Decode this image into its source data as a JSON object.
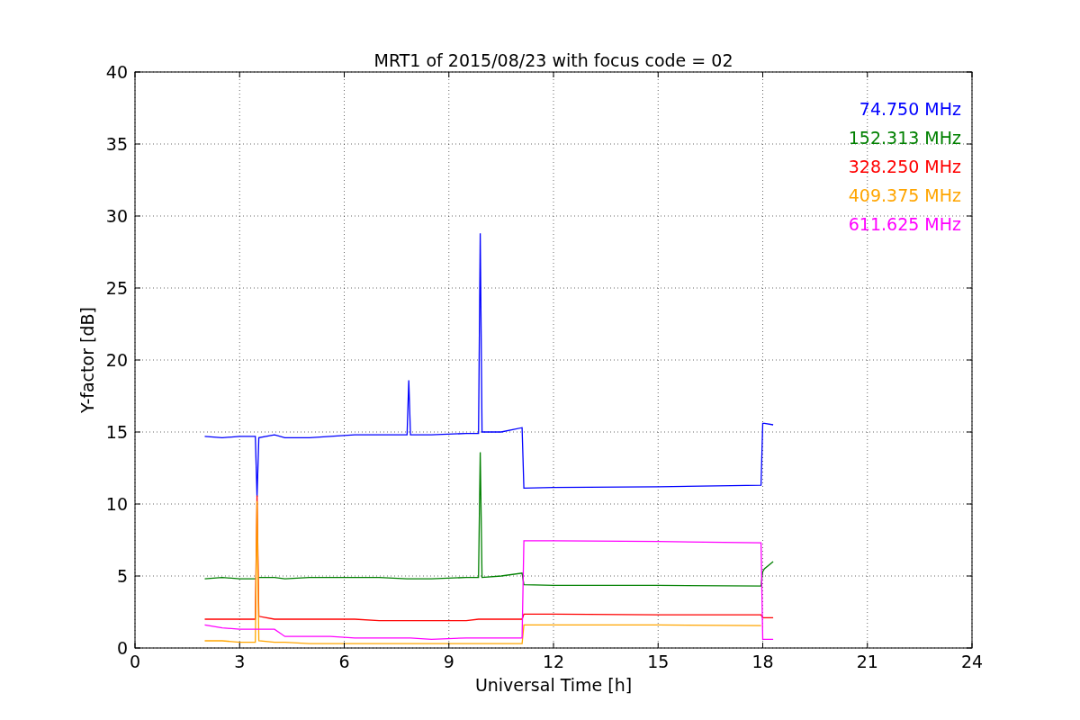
{
  "chart_data": {
    "type": "line",
    "title": "MRT1 of 2015/08/23 with focus code = 02",
    "xlabel": "Universal Time [h]",
    "ylabel": "Y-factor [dB]",
    "grid": true,
    "x": [
      2.0,
      2.5,
      3.0,
      3.45,
      3.5,
      3.55,
      4.0,
      4.3,
      5.0,
      5.6,
      6.3,
      7.0,
      7.8,
      7.85,
      7.9,
      8.5,
      9.5,
      9.85,
      9.9,
      9.95,
      10.5,
      11.1,
      11.15,
      12,
      15,
      17.95,
      18.0,
      18.05,
      18.3
    ],
    "series": [
      {
        "name": "74.750 MHz",
        "color": "#0000ff",
        "values": [
          14.7,
          14.6,
          14.7,
          14.7,
          10.5,
          14.6,
          14.8,
          14.6,
          14.6,
          14.7,
          14.8,
          14.8,
          14.8,
          18.6,
          14.8,
          14.8,
          14.9,
          14.9,
          28.8,
          15.0,
          15.0,
          15.3,
          11.1,
          11.15,
          11.2,
          11.3,
          15.6,
          15.6,
          15.5
        ]
      },
      {
        "name": "152.313 MHz",
        "color": "#008000",
        "values": [
          4.8,
          4.9,
          4.8,
          4.8,
          null,
          4.9,
          4.9,
          4.8,
          4.9,
          4.9,
          4.9,
          4.9,
          4.8,
          4.8,
          4.8,
          4.8,
          4.9,
          4.9,
          13.6,
          4.9,
          5.0,
          5.2,
          4.4,
          4.35,
          4.35,
          4.3,
          5.3,
          5.5,
          6.0
        ]
      },
      {
        "name": "328.250 MHz",
        "color": "#ff0000",
        "values": [
          2.0,
          2.0,
          2.0,
          2.0,
          10.6,
          2.2,
          2.0,
          2.0,
          2.0,
          2.0,
          2.0,
          1.9,
          1.9,
          1.9,
          1.9,
          1.9,
          1.9,
          2.0,
          2.0,
          2.0,
          2.0,
          2.0,
          2.35,
          2.35,
          2.3,
          2.3,
          2.1,
          2.1,
          2.1
        ]
      },
      {
        "name": "409.375 MHz",
        "color": "#ffa500",
        "values": [
          0.5,
          0.5,
          0.4,
          0.4,
          10.2,
          0.5,
          0.4,
          0.4,
          0.3,
          0.3,
          0.3,
          0.3,
          0.3,
          0.3,
          0.3,
          0.3,
          0.3,
          0.3,
          0.3,
          0.3,
          0.3,
          0.3,
          1.6,
          1.6,
          1.6,
          1.55,
          null,
          null,
          null
        ]
      },
      {
        "name": "611.625 MHz",
        "color": "#ff00ff",
        "values": [
          1.6,
          1.4,
          1.3,
          1.3,
          1.3,
          1.3,
          1.3,
          0.8,
          0.8,
          0.8,
          0.7,
          0.7,
          0.7,
          0.7,
          0.7,
          0.6,
          0.7,
          0.7,
          0.7,
          0.7,
          0.7,
          0.7,
          7.45,
          7.45,
          7.4,
          7.3,
          0.6,
          0.6,
          0.6
        ]
      }
    ],
    "xlim": [
      0,
      24
    ],
    "ylim": [
      0,
      40
    ],
    "xticks": [
      0,
      3,
      6,
      9,
      12,
      15,
      18,
      21,
      24
    ],
    "yticks": [
      0,
      5,
      10,
      15,
      20,
      25,
      30,
      35,
      40
    ]
  }
}
